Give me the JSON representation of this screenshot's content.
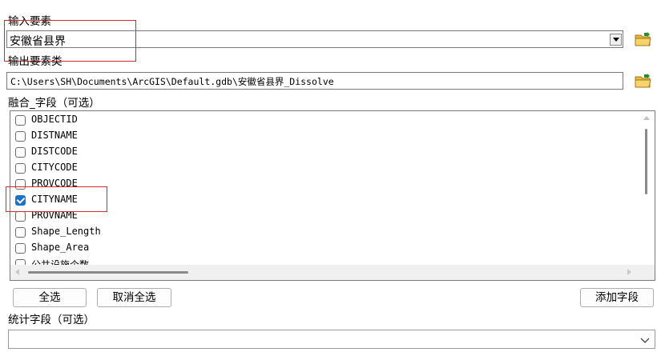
{
  "input_features": {
    "label": "输入要素",
    "value": "安徽省县界"
  },
  "output_feature_class": {
    "label": "输出要素类",
    "value": "C:\\Users\\SH\\Documents\\ArcGIS\\Default.gdb\\安徽省县界_Dissolve"
  },
  "dissolve_fields": {
    "label": "融合_字段（可选）",
    "items": [
      {
        "name": "OBJECTID",
        "checked": false
      },
      {
        "name": "DISTNAME",
        "checked": false
      },
      {
        "name": "DISTCODE",
        "checked": false
      },
      {
        "name": "CITYCODE",
        "checked": false
      },
      {
        "name": "PROVCODE",
        "checked": false
      },
      {
        "name": "CITYNAME",
        "checked": true
      },
      {
        "name": "PROVNAME",
        "checked": false
      },
      {
        "name": "Shape_Length",
        "checked": false
      },
      {
        "name": "Shape_Area",
        "checked": false
      },
      {
        "name": "公共设施个数",
        "checked": false
      }
    ]
  },
  "buttons": {
    "select_all": "全选",
    "unselect_all": "取消全选",
    "add_field": "添加字段"
  },
  "statistics_fields": {
    "label": "统计字段（可选）",
    "value": ""
  },
  "colors": {
    "highlight_box": "#d22b2b",
    "checkbox_checked": "#1a73c8"
  },
  "icons": {
    "browse": "open-folder-icon",
    "dropdown": "chevron-down-icon"
  }
}
